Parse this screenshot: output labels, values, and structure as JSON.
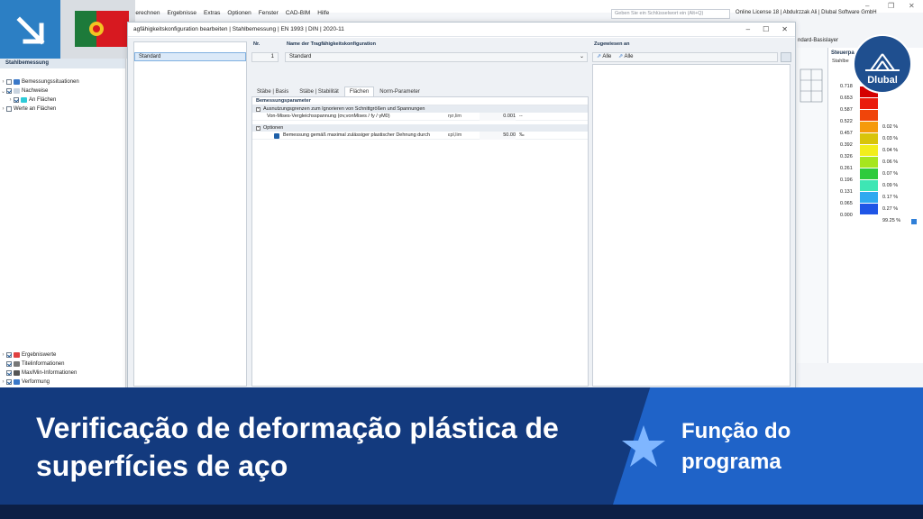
{
  "app": {
    "menu": [
      "Berechnen",
      "Ergebnisse",
      "Extras",
      "Optionen",
      "Fenster",
      "CAD-BIM",
      "Hilfe"
    ],
    "search_placeholder": "Geben Sie ein Schlüsselwort ein (Alt+Q)",
    "license": "Online License 18 | Abdulrzzak Ali | Dlubal Software GmbH"
  },
  "navigator": {
    "title": "Stahlbemessung",
    "items": [
      {
        "label": "Bemessungssituationen"
      },
      {
        "label": "Nachweise"
      },
      {
        "label": "An Flächen"
      },
      {
        "label": "Werte an Flächen"
      }
    ],
    "bottom_items": [
      {
        "label": "Ergebniswerte"
      },
      {
        "label": "Titelinformationen"
      },
      {
        "label": "Max/Min-Informationen"
      },
      {
        "label": "Verformung"
      }
    ]
  },
  "dialog": {
    "title": "agfähigkeitskonfiguration bearbeiten | Stahlbemessung | EN 1993 | DIN | 2020-11",
    "list_selected": "Standard",
    "no_label": "Nr.",
    "no_value": "1",
    "name_label": "Name der Tragfähigkeitskonfiguration",
    "name_value": "Standard",
    "assigned_label": "Zugewiesen an",
    "assigned_value_1": "Alle",
    "assigned_value_2": "Alle",
    "tabs": [
      "Stäbe | Basis",
      "Stäbe | Stabilität",
      "Flächen",
      "Norm-Parameter"
    ],
    "active_tab": "Flächen",
    "params_header": "Bemessungsparameter",
    "section1": "Ausnutzungsgrenzen zum Ignorieren von Schnittgrößen und Spannungen",
    "row1": {
      "label": "Von-Mises-Vergleichsspannung (σv,vonMises / fy / γM0)",
      "symbol": "ησ,lim",
      "value": "0.001",
      "unit": "--"
    },
    "section2": "Optionen",
    "row2": {
      "label": "Bemessung gemäß maximal zulässiger plastischer Dehnung durch",
      "symbol": "εpl,lim",
      "value": "50.00",
      "unit": "‰"
    }
  },
  "steuer": {
    "title": "Steuerpa",
    "subtitle": "Stahlbe",
    "layer": "ndard-Basislayer",
    "legend": [
      {
        "value": "0.718",
        "color": "#d40000",
        "pct": ""
      },
      {
        "value": "0.653",
        "color": "#ea1c0c",
        "pct": ""
      },
      {
        "value": "0.587",
        "color": "#f0450a",
        "pct": ""
      },
      {
        "value": "0.522",
        "color": "#f59a0c",
        "pct": "0.02 %"
      },
      {
        "value": "0.457",
        "color": "#d8c40a",
        "pct": "0.03 %"
      },
      {
        "value": "0.392",
        "color": "#f2ee1c",
        "pct": "0.04 %"
      },
      {
        "value": "0.326",
        "color": "#a6e61e",
        "pct": "0.06 %"
      },
      {
        "value": "0.261",
        "color": "#2ecb3c",
        "pct": "0.07 %"
      },
      {
        "value": "0.196",
        "color": "#3ee6b4",
        "pct": "0.09 %"
      },
      {
        "value": "0.131",
        "color": "#2fa9f0",
        "pct": "0.17 %"
      },
      {
        "value": "0.065",
        "color": "#1f55e6",
        "pct": "0.27 %"
      },
      {
        "value": "0.000",
        "color": "#0a14a8",
        "pct": "99.25 %"
      }
    ]
  },
  "brand": {
    "name": "Dlubal"
  },
  "banner": {
    "headline": "Verificação de deformação plástica de superfícies de aço",
    "tagline": "Função do programa"
  }
}
